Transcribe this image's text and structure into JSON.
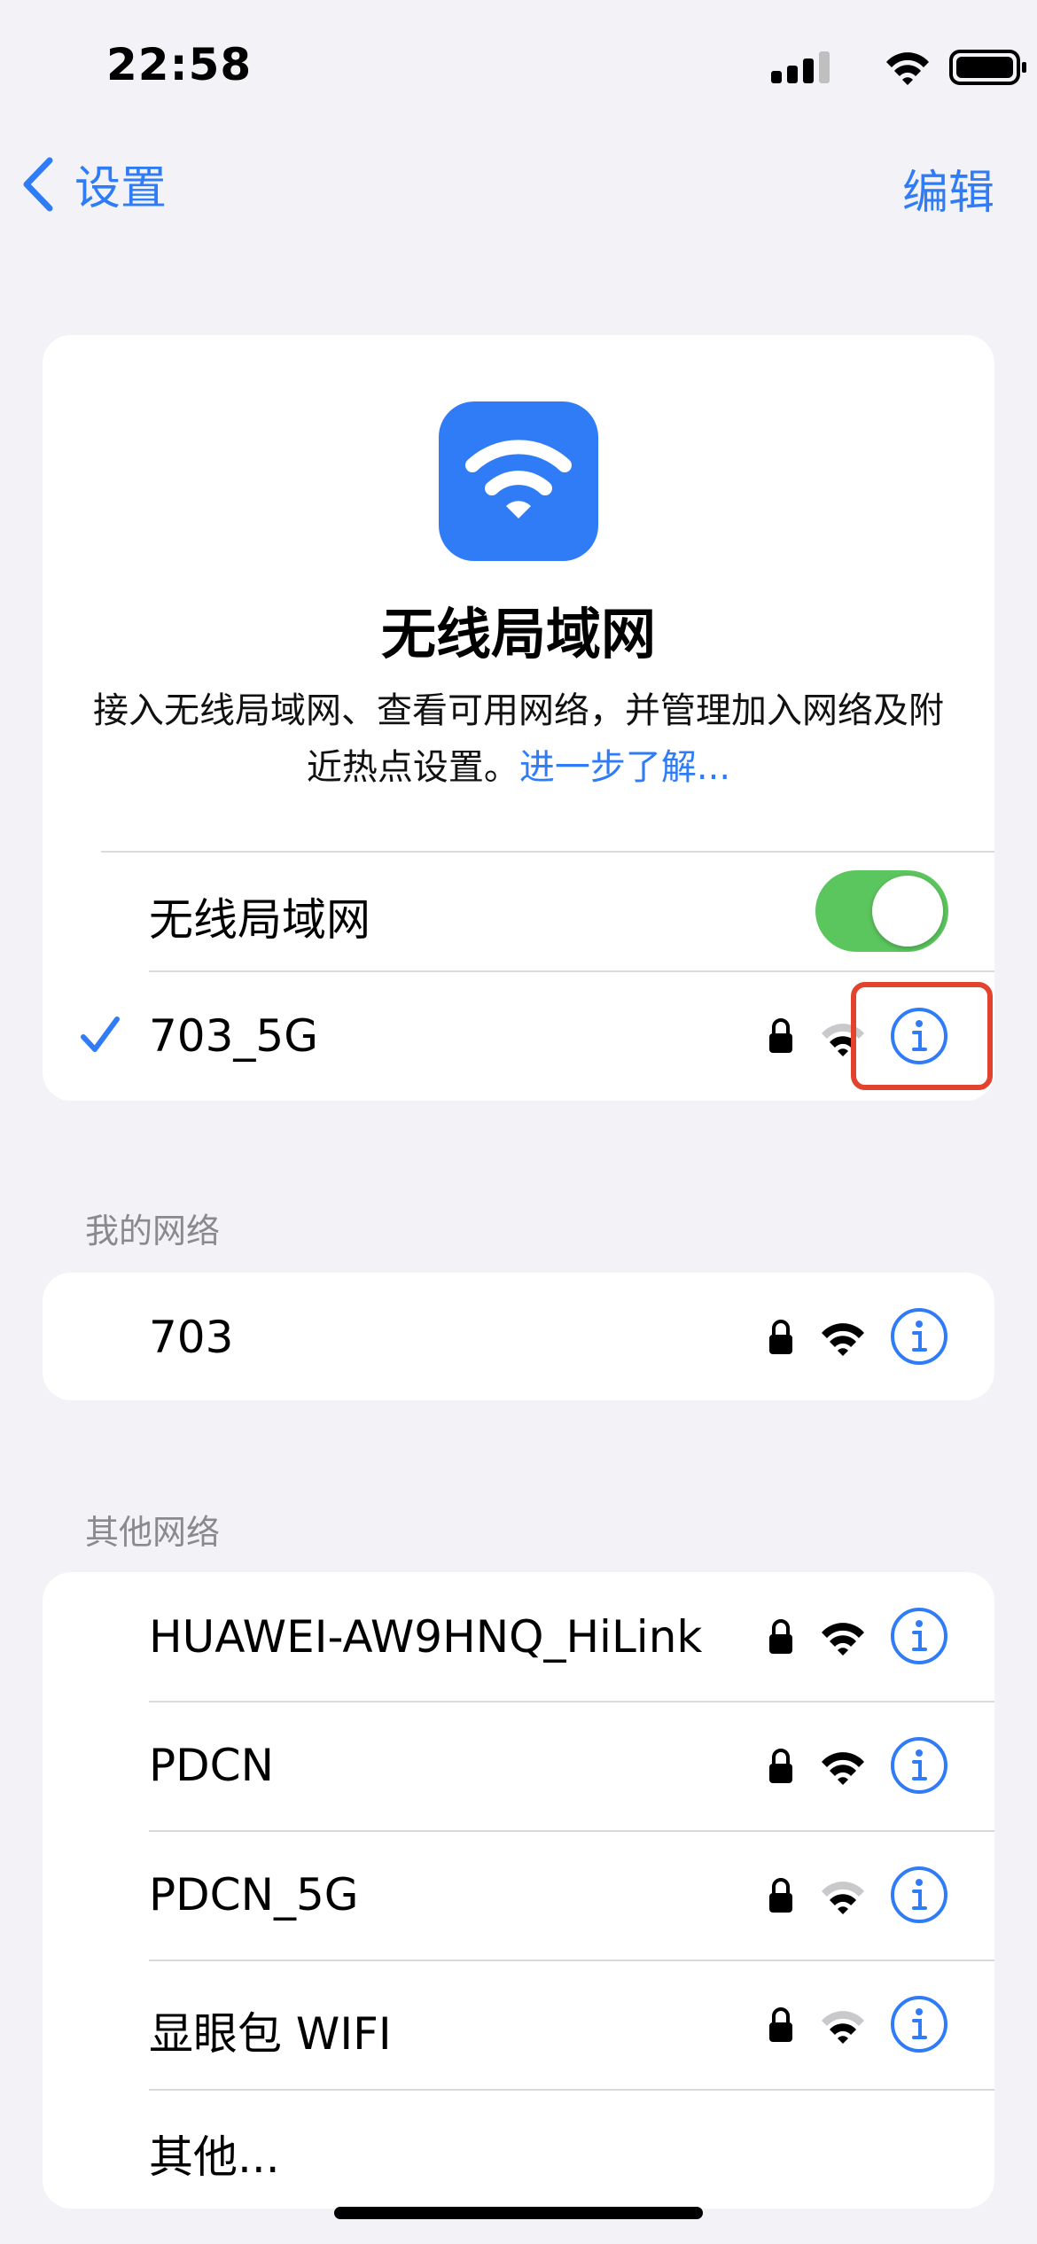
{
  "status_bar": {
    "time": "22:58"
  },
  "nav": {
    "back_label": "设置",
    "edit_label": "编辑"
  },
  "hero": {
    "title": "无线局域网",
    "description": "接入无线局域网、查看可用网络，并管理加入网络及附近热点设置。",
    "learn_more": "进一步了解..."
  },
  "wifi_toggle": {
    "label": "无线局域网",
    "on": true
  },
  "current_network": {
    "name": "703_5G",
    "checked": true,
    "locked": true,
    "signal": "weak"
  },
  "my_networks": {
    "header": "我的网络",
    "items": [
      {
        "name": "703",
        "locked": true,
        "signal": "strong"
      }
    ]
  },
  "other_networks": {
    "header": "其他网络",
    "items": [
      {
        "name": "HUAWEI-AW9HNQ_HiLink",
        "locked": true,
        "signal": "strong"
      },
      {
        "name": "PDCN",
        "locked": true,
        "signal": "strong"
      },
      {
        "name": "PDCN_5G",
        "locked": true,
        "signal": "weak"
      },
      {
        "name": "显眼包 WIFI",
        "locked": true,
        "signal": "weak"
      }
    ],
    "other_label": "其他..."
  },
  "colors": {
    "accent": "#2F7CF6",
    "toggle_on": "#5CC65E",
    "highlight": "#E2432E"
  }
}
